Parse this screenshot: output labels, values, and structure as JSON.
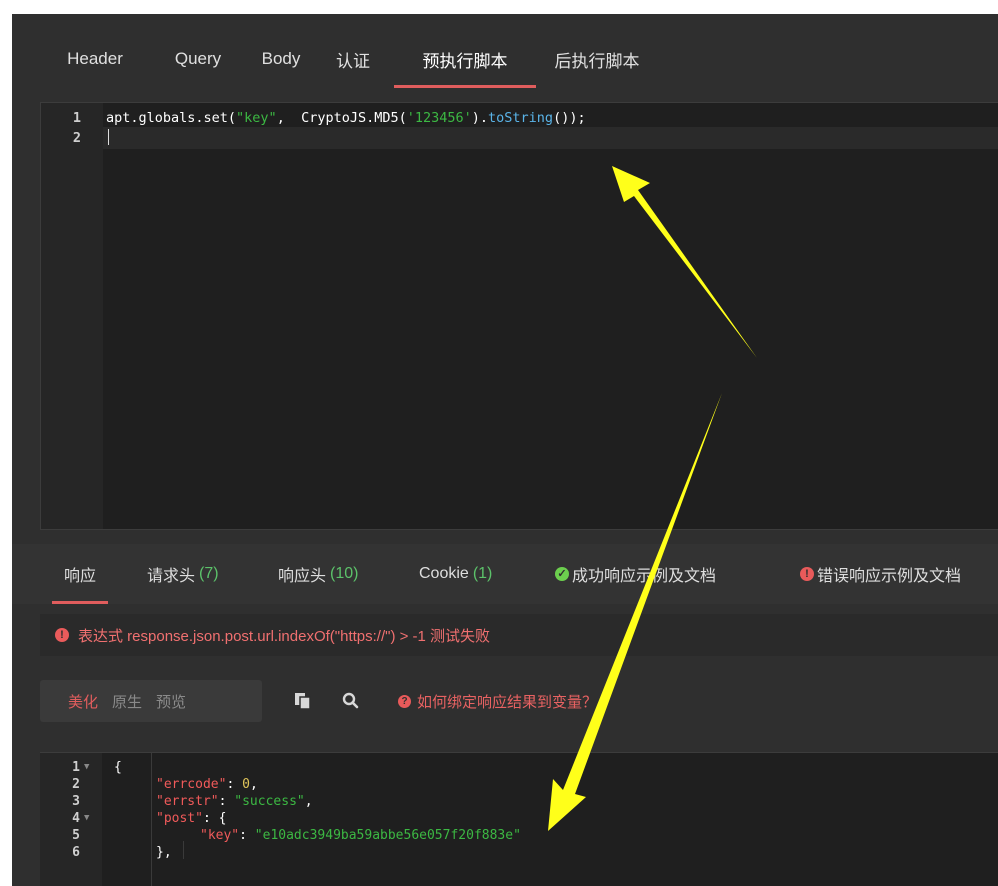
{
  "request_tabs": [
    {
      "label": "Header"
    },
    {
      "label": "Query"
    },
    {
      "label": "Body"
    },
    {
      "label": "认证"
    },
    {
      "label": "预执行脚本"
    },
    {
      "label": "后执行脚本"
    }
  ],
  "active_request_tab": "预执行脚本",
  "script_editor": {
    "line_numbers": [
      "1",
      "2"
    ],
    "line1": {
      "p1": "apt.globals.set(",
      "s1": "\"key\"",
      "p2": ",  CryptoJS.MD5(",
      "s2": "'123456'",
      "p3": ").",
      "fn": "toString",
      "p4": "());"
    }
  },
  "response_tabs": {
    "response": "响应",
    "request_headers": "请求头",
    "request_headers_count": "(7)",
    "response_headers": "响应头",
    "response_headers_count": "(10)",
    "cookie": "Cookie",
    "cookie_count": "(1)",
    "success_docs": "成功响应示例及文档",
    "error_docs": "错误响应示例及文档"
  },
  "assertion_error": "表达式 response.json.post.url.indexOf(\"https://\") > -1 测试失败",
  "format_buttons": {
    "pretty": "美化",
    "raw": "原生",
    "preview": "预览"
  },
  "help_link": "如何绑定响应结果到变量？",
  "response_json": {
    "line_numbers": [
      "1",
      "2",
      "3",
      "4",
      "5",
      "6"
    ],
    "brace_open": "{",
    "errcode_key": "\"errcode\"",
    "errcode_val": "0",
    "errstr_key": "\"errstr\"",
    "errstr_val": "\"success\"",
    "post_key": "\"post\"",
    "post_open": "{",
    "key_key": "\"key\"",
    "key_val": "\"e10adc3949ba59abbe56e057f20f883e\"",
    "post_close": "},"
  },
  "colors": {
    "background": "#2f2f2f",
    "editor_bg": "#1f1f1f",
    "accent_red": "#e05d5d",
    "string_green": "#3cb843",
    "count_green": "#5cc26a",
    "arrow_yellow": "#ffff1a"
  },
  "icons": [
    "copy-icon",
    "search-icon",
    "success-check-icon",
    "error-icon",
    "help-icon"
  ]
}
